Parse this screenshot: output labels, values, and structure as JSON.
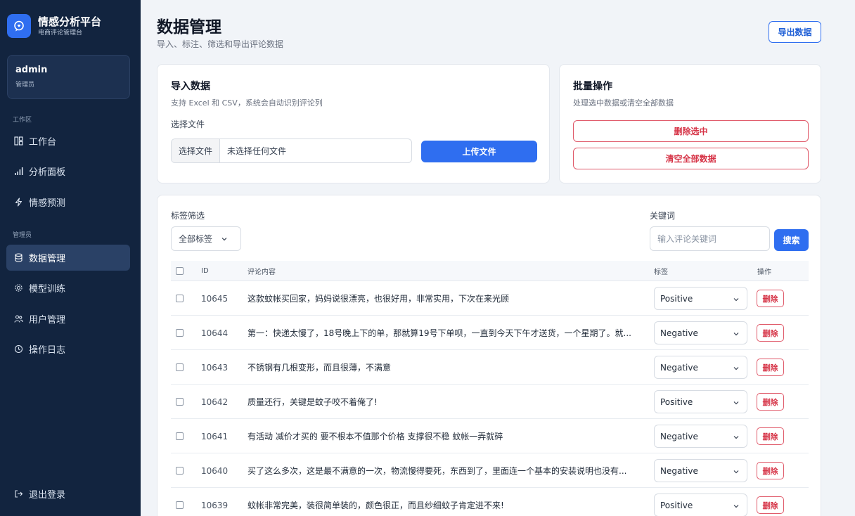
{
  "brand": {
    "title": "情感分析平台",
    "subtitle": "电商评论管理台"
  },
  "user": {
    "name": "admin",
    "role": "管理员"
  },
  "nav": {
    "section_work": "工作区",
    "section_admin": "管理员",
    "items": [
      {
        "label": "工作台",
        "icon": "layout-icon"
      },
      {
        "label": "分析面板",
        "icon": "bar-chart-icon"
      },
      {
        "label": "情感预测",
        "icon": "lightning-icon"
      },
      {
        "label": "数据管理",
        "icon": "database-icon",
        "active": true
      },
      {
        "label": "模型训练",
        "icon": "gear-icon"
      },
      {
        "label": "用户管理",
        "icon": "users-icon"
      },
      {
        "label": "操作日志",
        "icon": "clock-icon"
      }
    ],
    "logout": "退出登录"
  },
  "header": {
    "title": "数据管理",
    "subtitle": "导入、标注、筛选和导出评论数据",
    "export_label": "导出数据"
  },
  "import": {
    "title": "导入数据",
    "subtitle": "支持 Excel 和 CSV，系统会自动识别评论列",
    "file_label": "选择文件",
    "file_button": "选择文件",
    "file_status": "未选择任何文件",
    "upload_label": "上传文件"
  },
  "batch": {
    "title": "批量操作",
    "subtitle": "处理选中数据或清空全部数据",
    "delete_selected": "删除选中",
    "clear_all": "清空全部数据"
  },
  "filters": {
    "tag_label": "标签筛选",
    "tag_value": "全部标签",
    "keyword_label": "关键词",
    "keyword_placeholder": "输入评论关键词",
    "search_label": "搜索"
  },
  "table": {
    "headers": {
      "id": "ID",
      "content": "评论内容",
      "tag": "标签",
      "action": "操作"
    },
    "delete_label": "删除",
    "rows": [
      {
        "id": "10645",
        "content": "这款蚊帐买回家，妈妈说很漂亮，也很好用，非常实用，下次在来光顾",
        "tag": "Positive"
      },
      {
        "id": "10644",
        "content": "第一：快递太慢了，18号晚上下的单，那就算19号下单呗，一直到今天下午才送货，一个星期了。就...",
        "tag": "Negative"
      },
      {
        "id": "10643",
        "content": "不锈钢有几根变形，而且很薄，不满意",
        "tag": "Negative"
      },
      {
        "id": "10642",
        "content": "质量还行，关键是蚊子咬不着俺了!",
        "tag": "Positive"
      },
      {
        "id": "10641",
        "content": "有活动 减价才买的 要不根本不值那个价格 支撑很不稳 蚊帐一弄就碎",
        "tag": "Negative"
      },
      {
        "id": "10640",
        "content": "买了这么多次，这是最不满意的一次，物流慢得要死，东西到了，里面连一个基本的安装说明也没有...",
        "tag": "Negative"
      },
      {
        "id": "10639",
        "content": "蚊帐非常完美，装很简单装的，颜色很正，而且纱细蚊子肯定进不来!",
        "tag": "Positive"
      }
    ]
  }
}
